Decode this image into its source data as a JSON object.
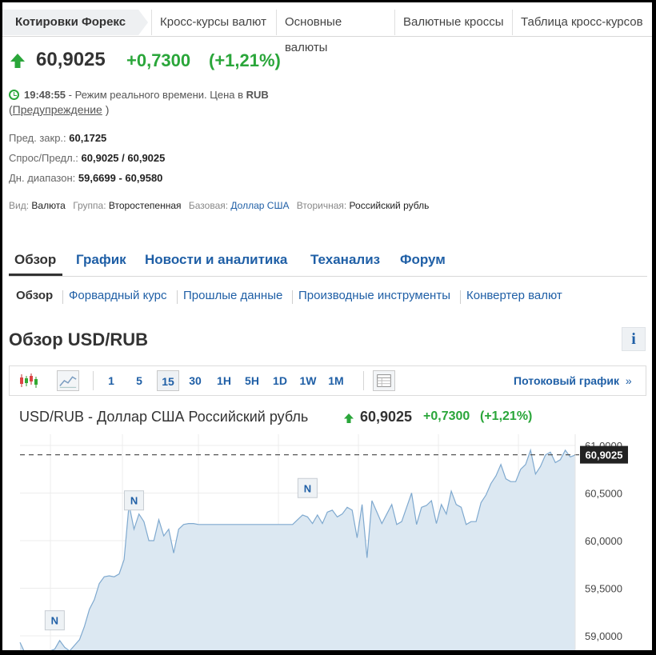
{
  "top_tabs": [
    {
      "label": "Котировки Форекс",
      "active": true
    },
    {
      "label": "Кросс-курсы валют"
    },
    {
      "label": "Основные валюты"
    },
    {
      "label": "Валютные кроссы"
    },
    {
      "label": "Таблица кросс-курсов"
    }
  ],
  "quote": {
    "price": "60,9025",
    "change": "+0,7300",
    "change_pct": "(+1,21%)",
    "time": "19:48:55",
    "time_note": "- Режим реального времени.  Цена в",
    "currency": "RUB",
    "warning_open": "(",
    "warning_link": "Предупреждение",
    "warning_close": ")"
  },
  "stats": {
    "prev_close_label": "Пред. закр.:",
    "prev_close": "60,1725",
    "bid_ask_label": "Спрос/Предл.:",
    "bid_ask": "60,9025 / 60,9025",
    "day_range_label": "Дн. диапазон:",
    "day_range": "59,6699 - 60,9580"
  },
  "meta": {
    "type_label": "Вид:",
    "type": "Валюта",
    "group_label": "Группа:",
    "group": "Второстепенная",
    "base_label": "Базовая:",
    "base": "Доллар США",
    "secondary_label": "Вторичная:",
    "secondary": "Российский рубль"
  },
  "main_nav": [
    "Обзор",
    "График",
    "Новости и аналитика",
    "Теханализ",
    "Форум"
  ],
  "sub_nav": [
    "Обзор",
    "Форвардный курс",
    "Прошлые данные",
    "Производные инструменты",
    "Конвертер валют"
  ],
  "overview_title": "Обзор USD/RUB",
  "info_label": "i",
  "toolbar": {
    "timeframes": [
      "1",
      "5",
      "15",
      "30",
      "1H",
      "5H",
      "1D",
      "1W",
      "1M"
    ],
    "active_timeframe": "15",
    "stream_label": "Потоковый график",
    "stream_arrow": "»",
    "icons": [
      "candlestick-icon",
      "area-chart-icon",
      "table-icon"
    ]
  },
  "chart_header": {
    "title": "USD/RUB - Доллар США Российский рубль",
    "price": "60,9025",
    "change": "+0,7300",
    "change_pct": "(+1,21%)"
  },
  "colors": {
    "up": "#2aa63a",
    "link": "#1f5fa6",
    "area_fill": "#dce8f2",
    "area_line": "#7fa9cf"
  },
  "chart_data": {
    "type": "area",
    "y_ticks": [
      "61,0000",
      "60,5000",
      "60,0000",
      "59,5000",
      "59,0000"
    ],
    "ylim": [
      58.86,
      61.14
    ],
    "current_value": 60.9025,
    "current_label": "60,9025",
    "news_marker_label": "N",
    "news_markers_at_index": [
      7,
      23,
      58
    ],
    "values": [
      58.93,
      58.82,
      58.78,
      58.8,
      58.82,
      58.8,
      58.84,
      58.86,
      58.95,
      58.88,
      58.84,
      58.9,
      58.96,
      59.1,
      59.28,
      59.38,
      59.55,
      59.62,
      59.63,
      59.62,
      59.65,
      59.8,
      60.38,
      60.12,
      60.28,
      60.2,
      60.0,
      60.0,
      60.22,
      60.05,
      60.12,
      59.87,
      60.12,
      60.17,
      60.18,
      60.18,
      60.17,
      60.17,
      60.17,
      60.17,
      60.17,
      60.17,
      60.17,
      60.17,
      60.17,
      60.17,
      60.17,
      60.17,
      60.17,
      60.17,
      60.17,
      60.17,
      60.17,
      60.17,
      60.17,
      60.17,
      60.22,
      60.27,
      60.25,
      60.18,
      60.27,
      60.18,
      60.3,
      60.32,
      60.25,
      60.28,
      60.35,
      60.32,
      60.03,
      60.38,
      59.82,
      60.42,
      60.3,
      60.18,
      60.28,
      60.38,
      60.17,
      60.2,
      60.35,
      60.5,
      60.17,
      60.35,
      60.37,
      60.42,
      60.18,
      60.38,
      60.28,
      60.52,
      60.38,
      60.35,
      60.17,
      60.2,
      60.2,
      60.4,
      60.48,
      60.6,
      60.68,
      60.8,
      60.65,
      60.62,
      60.62,
      60.75,
      60.8,
      60.95,
      60.7,
      60.78,
      60.9,
      60.93,
      60.82,
      60.85,
      60.95,
      60.88,
      60.9
    ]
  }
}
